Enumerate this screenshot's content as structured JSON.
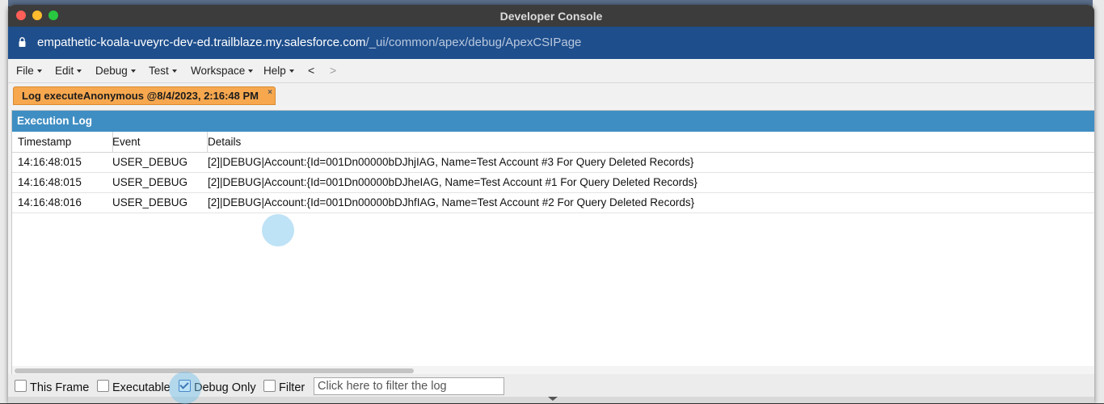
{
  "window": {
    "title": "Developer Console",
    "url_host": "empathetic-koala-uveyrc-dev-ed.trailblaze.my.salesforce.com",
    "url_path": "/_ui/common/apex/debug/ApexCSIPage"
  },
  "menu": {
    "items": [
      {
        "label": "File"
      },
      {
        "label": "Edit"
      },
      {
        "label": "Debug"
      },
      {
        "label": "Test"
      },
      {
        "label": "Workspace"
      },
      {
        "label": "Help"
      }
    ],
    "back": "<",
    "forward": ">"
  },
  "tab": {
    "label": "Log executeAnonymous @8/4/2023, 2:16:48 PM",
    "close": "×"
  },
  "log": {
    "title": "Execution Log",
    "columns": [
      "Timestamp",
      "Event",
      "Details"
    ],
    "rows": [
      {
        "timestamp": "14:16:48:015",
        "event": "USER_DEBUG",
        "details": "[2]|DEBUG|Account:{Id=001Dn00000bDJhjIAG, Name=Test Account #3 For Query Deleted Records}"
      },
      {
        "timestamp": "14:16:48:015",
        "event": "USER_DEBUG",
        "details": "[2]|DEBUG|Account:{Id=001Dn00000bDJheIAG, Name=Test Account #1 For Query Deleted Records}"
      },
      {
        "timestamp": "14:16:48:016",
        "event": "USER_DEBUG",
        "details": "[2]|DEBUG|Account:{Id=001Dn00000bDJhfIAG, Name=Test Account #2 For Query Deleted Records}"
      }
    ]
  },
  "filters": {
    "this_frame": {
      "label": "This Frame",
      "checked": false
    },
    "executable": {
      "label": "Executable",
      "checked": false
    },
    "debug_only": {
      "label": "Debug Only",
      "checked": true
    },
    "filter": {
      "label": "Filter",
      "checked": false
    },
    "filter_placeholder": "Click here to filter the log"
  },
  "colors": {
    "titlebar": "#3c3c3c",
    "urlbar": "#1e4e8c",
    "tab": "#f7a84f",
    "log_header": "#3f8ec3"
  }
}
